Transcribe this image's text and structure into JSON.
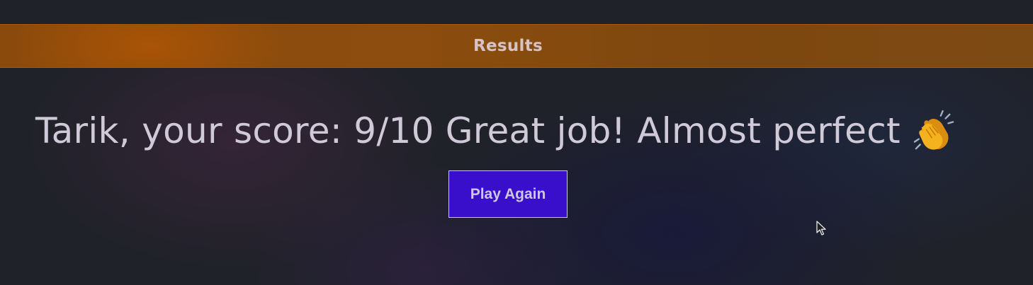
{
  "header": {
    "title": "Results"
  },
  "result": {
    "player_name": "Tarik",
    "score_prefix": "Tarik, your score: 9/10",
    "message": "Great job! Almost perfect",
    "icon": "clapping-hands-icon"
  },
  "actions": {
    "play_again_label": "Play Again"
  },
  "colors": {
    "header_bar": "#8a4a0c",
    "button_bg": "#3a0fcb",
    "text": "#cfc9d8",
    "background": "#202229"
  }
}
